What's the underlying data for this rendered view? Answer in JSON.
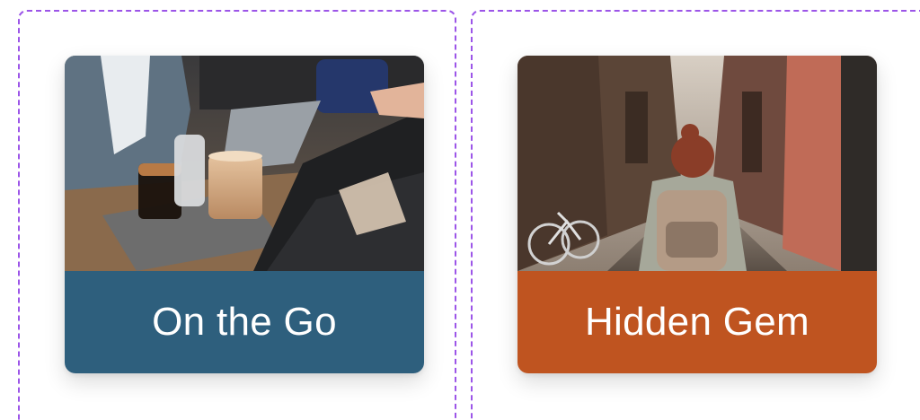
{
  "cards": [
    {
      "label": "On the Go",
      "image": "cafe-laptop-coffee-photo",
      "color": "#2e5f7d"
    },
    {
      "label": "Hidden Gem",
      "image": "alley-backpacker-photo",
      "color": "#bf5420"
    }
  ],
  "frame_color": "#9c55e8"
}
